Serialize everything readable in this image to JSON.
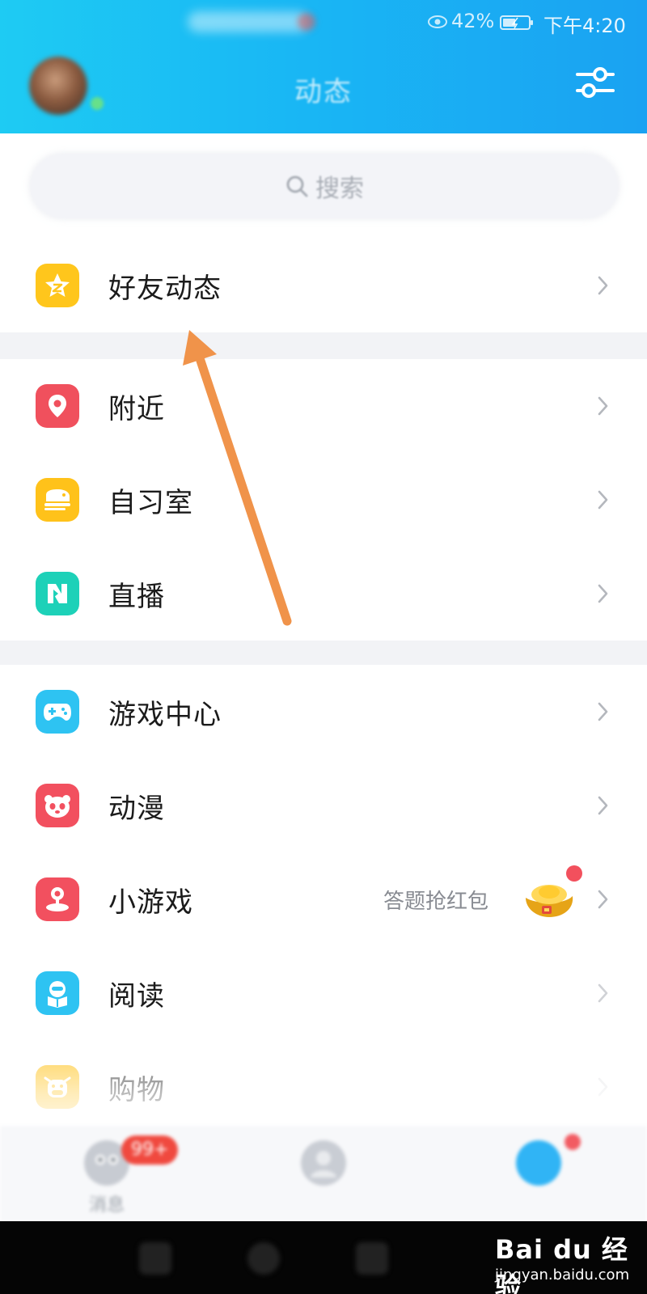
{
  "status_bar": {
    "battery": "42%",
    "time": "下午4:20"
  },
  "header": {
    "title": "动态"
  },
  "search": {
    "placeholder": "搜索"
  },
  "groups": [
    [
      {
        "label": "好友动态",
        "icon": "star-icon",
        "color": "#ffc61c"
      }
    ],
    [
      {
        "label": "附近",
        "icon": "location-pin-icon",
        "color": "#f0505d"
      },
      {
        "label": "自习室",
        "icon": "study-room-icon",
        "color": "#ffc21a"
      },
      {
        "label": "直播",
        "icon": "live-n-icon",
        "color": "#1dd1b8"
      }
    ],
    [
      {
        "label": "游戏中心",
        "icon": "gamepad-icon",
        "color": "#2ec3f2"
      },
      {
        "label": "动漫",
        "icon": "panda-icon",
        "color": "#f2505f"
      },
      {
        "label": "小游戏",
        "icon": "joystick-icon",
        "color": "#f2505f",
        "extra": "答题抢红包"
      },
      {
        "label": "阅读",
        "icon": "reader-icon",
        "color": "#2ec3f2"
      },
      {
        "label": "购物",
        "icon": "cow-icon",
        "color": "#ffc21a"
      }
    ]
  ],
  "tabbar": {
    "messages_label": "消息",
    "messages_badge": "99+"
  },
  "watermark": {
    "main": "Bai du 经验",
    "sub": "jingyan.baidu.com"
  },
  "colors": {
    "header_start": "#1ecbf3",
    "header_end": "#1aa2f2",
    "arrow": "#f0934a",
    "divider": "#f2f3f6"
  }
}
